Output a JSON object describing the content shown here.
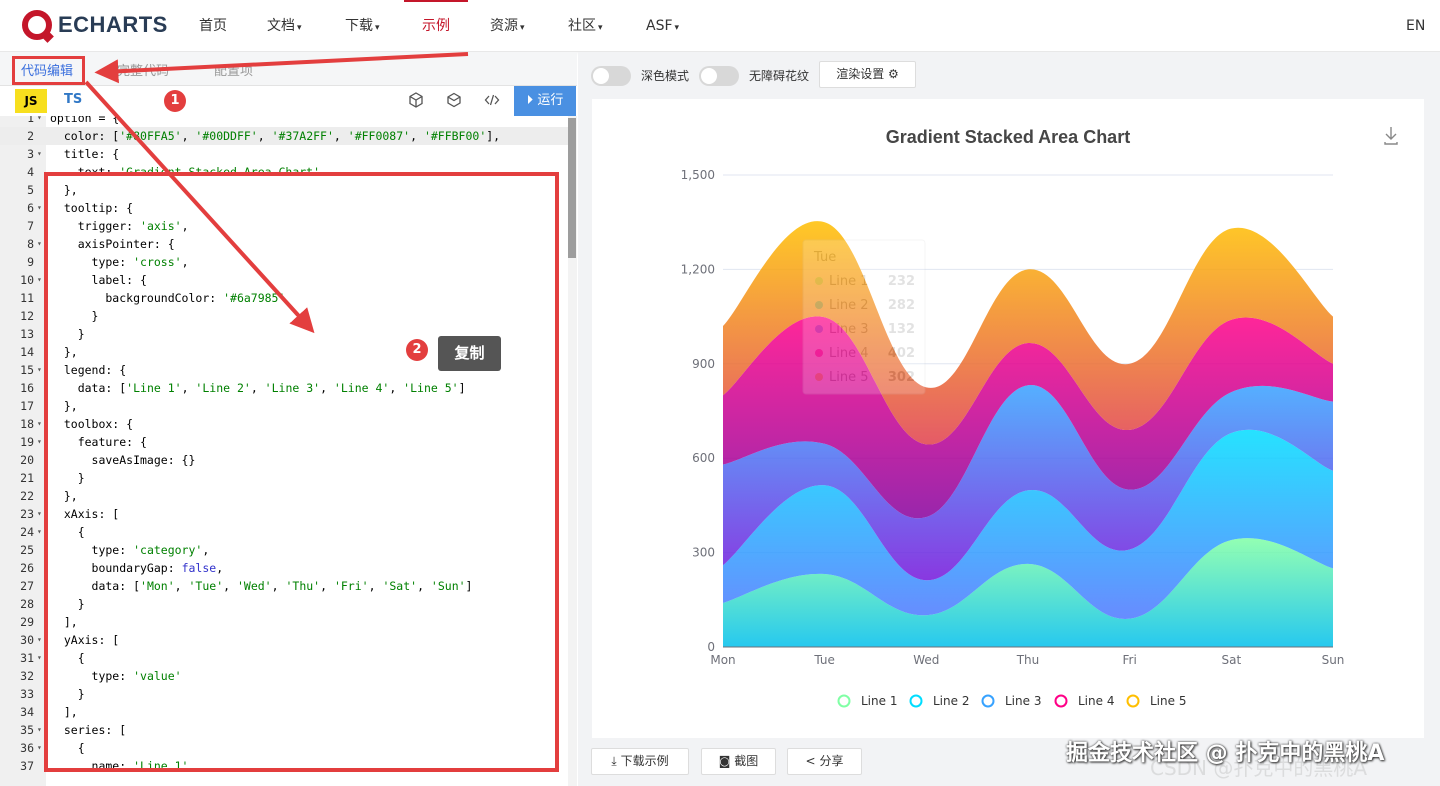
{
  "nav": {
    "logo_text": "ECHARTS",
    "items": [
      {
        "label": "首页"
      },
      {
        "label": "文档",
        "caret": "▾"
      },
      {
        "label": "下载",
        "caret": "▾"
      },
      {
        "label": "示例"
      },
      {
        "label": "资源",
        "caret": "▾"
      },
      {
        "label": "社区",
        "caret": "▾"
      },
      {
        "label": "ASF",
        "caret": "▾"
      }
    ],
    "lang": "EN"
  },
  "editor_tabs": [
    {
      "label": "代码编辑"
    },
    {
      "label": "完整代码"
    },
    {
      "label": "配置项"
    }
  ],
  "toolbar": {
    "js_label": "JS",
    "ts_label": "TS",
    "run_label": "运行",
    "icons": [
      "codesandbox-icon",
      "codepen-icon",
      "code-icon"
    ]
  },
  "annotations": {
    "step1": "1",
    "step2": "2",
    "copy_label": "复制"
  },
  "code_lines": [
    {
      "n": "1",
      "fold": true,
      "text": "option = {"
    },
    {
      "n": "2",
      "text": "  color: ['#80FFA5', '#00DDFF', '#37A2FF', '#FF0087', '#FFBF00'],"
    },
    {
      "n": "3",
      "fold": true,
      "text": "  title: {"
    },
    {
      "n": "4",
      "text": "    text: 'Gradient Stacked Area Chart'"
    },
    {
      "n": "5",
      "text": "  },"
    },
    {
      "n": "6",
      "fold": true,
      "text": "  tooltip: {"
    },
    {
      "n": "7",
      "text": "    trigger: 'axis',"
    },
    {
      "n": "8",
      "fold": true,
      "text": "    axisPointer: {"
    },
    {
      "n": "9",
      "text": "      type: 'cross',"
    },
    {
      "n": "10",
      "fold": true,
      "text": "      label: {"
    },
    {
      "n": "11",
      "text": "        backgroundColor: '#6a7985'"
    },
    {
      "n": "12",
      "text": "      }"
    },
    {
      "n": "13",
      "text": "    }"
    },
    {
      "n": "14",
      "text": "  },"
    },
    {
      "n": "15",
      "fold": true,
      "text": "  legend: {"
    },
    {
      "n": "16",
      "text": "    data: ['Line 1', 'Line 2', 'Line 3', 'Line 4', 'Line 5']"
    },
    {
      "n": "17",
      "text": "  },"
    },
    {
      "n": "18",
      "fold": true,
      "text": "  toolbox: {"
    },
    {
      "n": "19",
      "fold": true,
      "text": "    feature: {"
    },
    {
      "n": "20",
      "text": "      saveAsImage: {}"
    },
    {
      "n": "21",
      "text": "    }"
    },
    {
      "n": "22",
      "text": "  },"
    },
    {
      "n": "23",
      "fold": true,
      "text": "  xAxis: ["
    },
    {
      "n": "24",
      "fold": true,
      "text": "    {"
    },
    {
      "n": "25",
      "text": "      type: 'category',"
    },
    {
      "n": "26",
      "text": "      boundaryGap: false,"
    },
    {
      "n": "27",
      "text": "      data: ['Mon', 'Tue', 'Wed', 'Thu', 'Fri', 'Sat', 'Sun']"
    },
    {
      "n": "28",
      "text": "    }"
    },
    {
      "n": "29",
      "text": "  ],"
    },
    {
      "n": "30",
      "fold": true,
      "text": "  yAxis: ["
    },
    {
      "n": "31",
      "fold": true,
      "text": "    {"
    },
    {
      "n": "32",
      "text": "      type: 'value'"
    },
    {
      "n": "33",
      "text": "    }"
    },
    {
      "n": "34",
      "text": "  ],"
    },
    {
      "n": "35",
      "fold": true,
      "text": "  series: ["
    },
    {
      "n": "36",
      "fold": true,
      "text": "    {"
    },
    {
      "n": "37",
      "text": "      name: 'Line 1',"
    }
  ],
  "right_panel": {
    "dark_mode_label": "深色模式",
    "decal_label": "无障碍花纹",
    "render_settings_label": "渲染设置",
    "download_label": "下载示例",
    "screenshot_label": "截图",
    "share_label": "分享"
  },
  "chart_data": {
    "type": "area",
    "title": "Gradient Stacked Area Chart",
    "categories": [
      "Mon",
      "Tue",
      "Wed",
      "Thu",
      "Fri",
      "Sat",
      "Sun"
    ],
    "ylim": [
      0,
      1500
    ],
    "yticks": [
      "0",
      "300",
      "600",
      "900",
      "1,200",
      "1,500"
    ],
    "stacked": true,
    "smooth": true,
    "legend_position": "bottom",
    "grid": true,
    "series": [
      {
        "name": "Line 1",
        "color": "#80FFA5",
        "values": [
          140,
          232,
          101,
          264,
          90,
          340,
          250
        ]
      },
      {
        "name": "Line 2",
        "color": "#00DDFF",
        "values": [
          120,
          282,
          111,
          234,
          220,
          340,
          310
        ]
      },
      {
        "name": "Line 3",
        "color": "#37A2FF",
        "values": [
          320,
          132,
          201,
          334,
          190,
          130,
          220
        ]
      },
      {
        "name": "Line 4",
        "color": "#FF0087",
        "values": [
          220,
          402,
          231,
          134,
          190,
          230,
          120
        ]
      },
      {
        "name": "Line 5",
        "color": "#FFBF00",
        "values": [
          220,
          302,
          181,
          234,
          210,
          290,
          150
        ]
      }
    ],
    "tooltip": {
      "title": "Tue",
      "rows": [
        {
          "name": "Line 1",
          "value": "232"
        },
        {
          "name": "Line 2",
          "value": "282"
        },
        {
          "name": "Line 3",
          "value": "132"
        },
        {
          "name": "Line 4",
          "value": "402"
        },
        {
          "name": "Line 5",
          "value": "302"
        }
      ]
    }
  },
  "watermark": {
    "main": "掘金技术社区 @ 扑克中的黑桃A",
    "faint": "CSDN @扑克中的黑桃A"
  }
}
